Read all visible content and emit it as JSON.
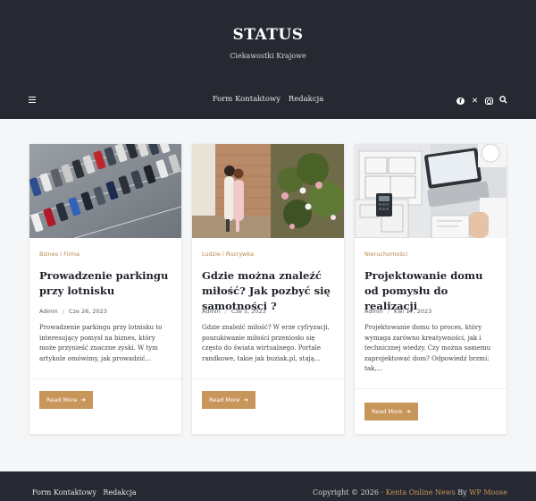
{
  "header": {
    "title": "STATUS",
    "description": "Ciekawostki Krajowe",
    "nav": [
      "Form Kontaktowy",
      "Redakcja"
    ],
    "social_icons": [
      "facebook-icon",
      "x-icon",
      "instagram-icon",
      "search-icon"
    ]
  },
  "posts": [
    {
      "category": "Biznes i Firma",
      "title": "Prowadzenie parkingu przy lotnisku",
      "author": "Admin",
      "date": "Cze 26, 2023",
      "excerpt": "Prowadzenie parkingu przy lotnisku to interesujący pomysł na biznes, który może przynieść znaczne zyski. W tym artykule omówimy, jak prowadzić...",
      "button": "Read More",
      "image": "parking-lot-photo"
    },
    {
      "category": "Ludzie i Rozrywka",
      "title": "Gdzie można znaleźć miłość? Jak pozbyć się samotności ?",
      "author": "Admin",
      "date": "Cze 5, 2023",
      "excerpt": "Gdzie znaleźć miłość? W erze cyfryzacji, poszukiwanie miłości przeniosło się często do świata wirtualnego. Portale randkowe, takie jak buziak.pl, stają...",
      "button": "Read More",
      "image": "couple-photo"
    },
    {
      "category": "Nieruchomości",
      "title": "Projektowanie domu od pomysłu do realizacji",
      "author": "Admin",
      "date": "Kwi 17, 2023",
      "excerpt": "Projektowanie domu to proces, który wymaga zarówno kreatywności, jak i technicznej wiedzy. Czy można samemu zaprojektować dom? Odpowiedź brzmi: tak,...",
      "button": "Read More",
      "image": "house-plans-photo"
    }
  ],
  "footer": {
    "nav": [
      "Form Kontaktowy",
      "Redakcja"
    ],
    "copyright_prefix": "Copyright © 2026 · ",
    "theme_name": "Kenta Online News",
    "by": " By ",
    "author_link": "WP Moose"
  },
  "colors": {
    "header_bg": "#262931",
    "accent": "#c8955a",
    "page_bg": "#f4f6f8"
  }
}
